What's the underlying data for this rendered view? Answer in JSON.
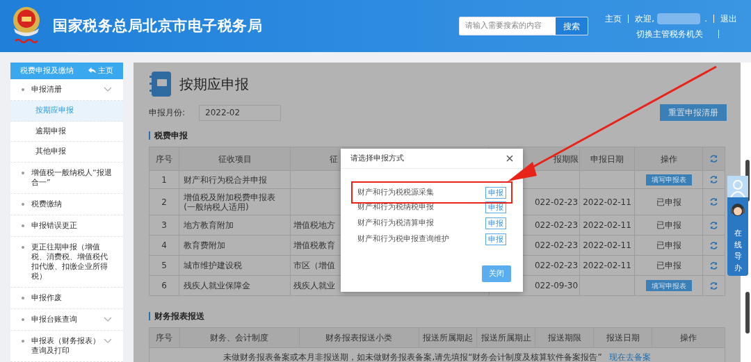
{
  "header": {
    "title": "国家税务总局北京市电子税务局",
    "search": {
      "placeholder": "请输入需要搜索的内容",
      "button": "搜索"
    },
    "links": [
      {
        "kind": "link",
        "text": "主页"
      },
      {
        "kind": "text",
        "text": "欢迎,"
      },
      {
        "kind": "blur",
        "text": "."
      },
      {
        "kind": "link",
        "text": "退出"
      }
    ],
    "switch_link": "切换主管税务机关"
  },
  "sidebar": {
    "title": "税费申报及缴纳",
    "home": "主页",
    "items": [
      {
        "label": "申报清册",
        "expandable": true,
        "selected": false,
        "children": [
          {
            "label": "按期应申报",
            "selected": true
          },
          {
            "label": "逾期申报",
            "selected": false
          },
          {
            "label": "其他申报",
            "selected": false
          }
        ]
      },
      {
        "label": "增值税一般纳税人“报退合一”",
        "expandable": false,
        "selected": false
      },
      {
        "label": "税费缴纳",
        "expandable": false,
        "selected": false
      },
      {
        "label": "申报错误更正",
        "expandable": false,
        "selected": false
      },
      {
        "label": "更正往期申报（增值税、消费税、增值税代扣代缴、扣缴企业所得税）",
        "expandable": false,
        "selected": false
      },
      {
        "label": "申报作废",
        "expandable": false,
        "selected": false
      },
      {
        "label": "申报台账查询",
        "expandable": true,
        "selected": false
      },
      {
        "label": "申报表（财务报表）查询及打印",
        "expandable": true,
        "selected": false
      }
    ]
  },
  "main": {
    "title": "按期应申报",
    "month_label": "申报月份:",
    "month_value": "2022-02",
    "reset_button": "重置申报清册",
    "tax_section": {
      "title": "税费申报",
      "columns": [
        "序号",
        "征收项目",
        "征",
        "报期限",
        "申报日期",
        "操作"
      ],
      "rows": [
        {
          "seq": "1",
          "item": "财产和行为税合并申报",
          "column_3": "",
          "deadline": "",
          "date": "",
          "action": {
            "kind": "button",
            "text": "填写申报表"
          }
        },
        {
          "seq": "2",
          "item": "增值税及附加税费申报表(一般纳税人适用)",
          "column_3": "",
          "deadline": "022-02-23",
          "date": "2022-02-11",
          "action": {
            "kind": "text",
            "text": "已申报"
          }
        },
        {
          "seq": "3",
          "item": "地方教育附加",
          "column_3": "增值税地方",
          "deadline": "022-02-23",
          "date": "2022-02-11",
          "action": {
            "kind": "text",
            "text": "已申报"
          }
        },
        {
          "seq": "4",
          "item": "教育费附加",
          "column_3": "增值税教育",
          "deadline": "022-02-23",
          "date": "2022-02-11",
          "action": {
            "kind": "text",
            "text": "已申报"
          }
        },
        {
          "seq": "5",
          "item": "城市维护建设税",
          "column_3": "市区（增值",
          "deadline": "022-02-23",
          "date": "2022-02-11",
          "action": {
            "kind": "text",
            "text": "已申报"
          }
        },
        {
          "seq": "6",
          "item": "残疾人就业保障金",
          "column_3": "残疾人就业",
          "deadline": "022-09-30",
          "date": "",
          "action": {
            "kind": "button",
            "text": "填写申报表"
          }
        }
      ]
    },
    "finance_section": {
      "title": "财务报表报送",
      "columns": [
        "序号",
        "财务、会计制度",
        "财务报表报送小类",
        "报送所属期起",
        "报送所属期止",
        "报送期限",
        "报送日期",
        "操作"
      ],
      "message": "未做财务报表备案或本月非报送期，如未做财务报表备案,请先填报“财务会计制度及核算软件备案报告”",
      "link": "现在去备案"
    }
  },
  "dialog": {
    "title": "请选择申报方式",
    "options": [
      {
        "label": "财产和行为税税源采集",
        "button": "申报",
        "highlighted": true
      },
      {
        "label": "财产和行为税纳税申报",
        "button": "申报",
        "highlighted": false
      },
      {
        "label": "财产和行为税清算申报",
        "button": "申报",
        "highlighted": false
      },
      {
        "label": "财产和行为税申报查询维护",
        "button": "申报",
        "highlighted": false
      }
    ],
    "close_button": "关闭"
  },
  "side_widget": {
    "label": "在线导办"
  }
}
